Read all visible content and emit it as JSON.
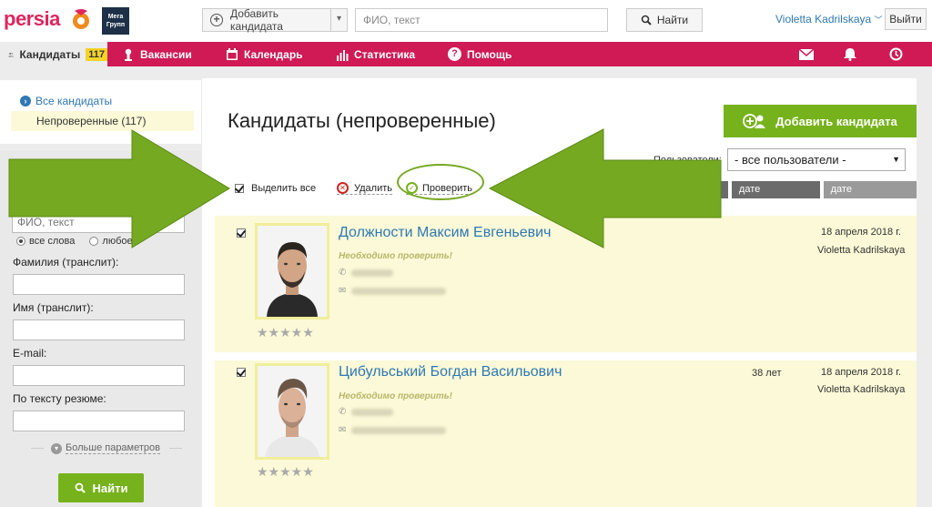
{
  "header": {
    "logo_text": "persia",
    "brand2_text": "Мега Групп",
    "add_candidate_dropdown_label": "Добавить кандидата",
    "search_placeholder": "ФИО, текст",
    "search_button_label": "Найти",
    "user_name": "Violetta Kadrilskaya",
    "logout_label": "Выйти"
  },
  "nav": {
    "items": [
      {
        "label": "Кандидаты",
        "icon": "people-icon",
        "badge": "117"
      },
      {
        "label": "Вакансии",
        "icon": "person-pin-icon"
      },
      {
        "label": "Календарь",
        "icon": "calendar-icon"
      },
      {
        "label": "Статистика",
        "icon": "bar-chart-icon"
      },
      {
        "label": "Помощь",
        "icon": "help-icon"
      }
    ],
    "right_icons": [
      "mail-icon",
      "bell-icon",
      "history-icon"
    ],
    "accent": "#cf1a56"
  },
  "sidebar": {
    "all_candidates": "Все кандидаты",
    "unverified": "Непроверенные (117)",
    "search": {
      "fio_placeholder": "ФИО, текст",
      "radio_all_words": "все слова",
      "radio_any": "любое",
      "surname_label": "Фамилия (транслит):",
      "name_label": "Имя (транслит):",
      "email_label": "E-mail:",
      "resume_label": "По тексту резюме:",
      "more_params": "Больше параметров",
      "find_button": "Найти"
    }
  },
  "main": {
    "title": "Кандидаты (непроверенные)",
    "add_button": "Добавить кандидата",
    "users_label": "Пользователи:",
    "users_select_value": "- все пользователи -",
    "toolbar": {
      "select_all": "Выделить все",
      "delete": "Удалить",
      "verify": "Проверить"
    },
    "sort_tabs": [
      "дате изменения",
      "дате добавления"
    ],
    "candidates": [
      {
        "name": "Должности Максим Евгеньевич",
        "status": "Необходимо проверить!",
        "age": "",
        "date": "18 апреля 2018 г.",
        "owner": "Violetta Kadrilskaya",
        "rating": "★★★★★"
      },
      {
        "name": "Цибульський Богдан Васильович",
        "status": "Необходимо проверить!",
        "age": "38 лет",
        "date": "18 апреля 2018 г.",
        "owner": "Violetta Kadrilskaya",
        "rating": "★★★★★"
      }
    ]
  },
  "colors": {
    "brand_pink": "#cf1a56",
    "accent_green": "#76b21b",
    "link_blue": "#2f78b4",
    "row_bg": "#fbf9d7",
    "arrow_green": "#76a922"
  }
}
